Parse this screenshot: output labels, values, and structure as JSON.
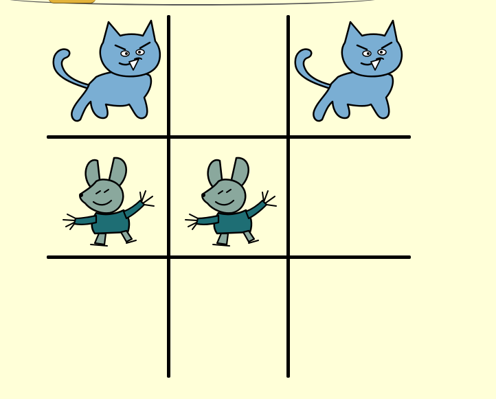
{
  "game": {
    "type": "tic-tac-toe",
    "players": [
      "cat",
      "mouse"
    ],
    "board": [
      [
        "cat",
        "",
        "cat"
      ],
      [
        "mouse",
        "mouse",
        ""
      ],
      [
        "",
        "",
        ""
      ]
    ]
  },
  "colors": {
    "background": "#ffffd8",
    "grid": "#000000",
    "cat_fill": "#7aaed3",
    "mouse_fill": "#8aa89d",
    "mouse_shirt": "#1e6e74",
    "outline": "#000000",
    "tab_accent": "#e2b23a"
  },
  "icons": {
    "cat": "cat-icon",
    "mouse": "mouse-icon"
  }
}
